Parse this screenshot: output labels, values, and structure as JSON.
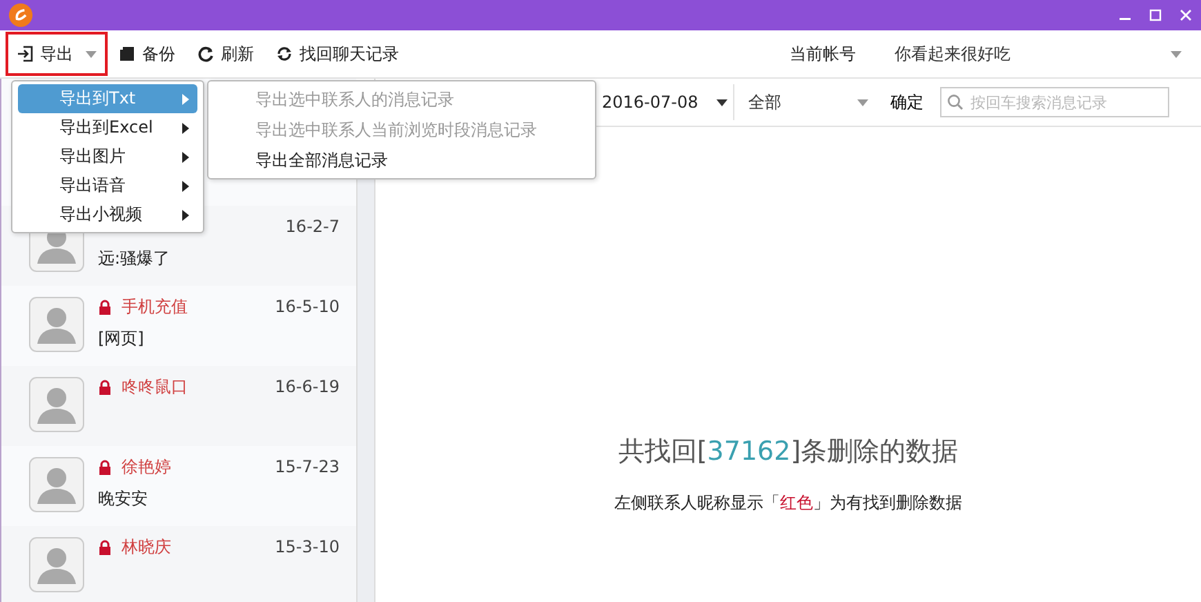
{
  "toolbar": {
    "buttons": [
      {
        "kind": "export",
        "label": "导出",
        "highlighted": true
      },
      {
        "kind": "backup",
        "label": "备份",
        "highlighted": false
      },
      {
        "kind": "refresh",
        "label": "刷新",
        "highlighted": false
      },
      {
        "kind": "recover",
        "label": "找回聊天记录",
        "highlighted": false
      }
    ],
    "account_label": "当前帐号",
    "account": "你看起来很好吃"
  },
  "filter": {
    "date": "2016-07-08",
    "type": "全部",
    "confirm": "确定",
    "search": {
      "placeholder": "按回车搜索消息记录"
    }
  },
  "export_menu": [
    {
      "label": "导出到Txt",
      "selected": true
    },
    {
      "label": "导出到Excel",
      "selected": false
    },
    {
      "label": "导出图片",
      "selected": false
    },
    {
      "label": "导出语音",
      "selected": false
    },
    {
      "label": "导出小视频",
      "selected": false
    }
  ],
  "submenu": [
    {
      "label": "导出选中联系人的消息记录",
      "disabled": true
    },
    {
      "label": "导出选中联系人当前浏览时段消息记录",
      "disabled": true
    },
    {
      "label": "导出全部消息记录",
      "disabled": false
    }
  ],
  "contacts": [
    {
      "date": "16-2-7",
      "message": "远:骚爆了",
      "locked": false
    },
    {
      "name": "手机充值",
      "date": "16-5-10",
      "message": "[网页]",
      "locked": true
    },
    {
      "name": "咚咚鼠口",
      "date": "16-6-19",
      "locked": true
    },
    {
      "name": "徐艳婷",
      "date": "15-7-23",
      "message": "晚安安",
      "locked": true
    },
    {
      "name": "林晓庆",
      "date": "15-3-10",
      "locked": true
    }
  ],
  "summary": {
    "before": "共找回[",
    "count": "37162",
    "after": "]条删除的数据"
  },
  "note": {
    "before": "左侧联系人昵称显示「",
    "highlight": "红色",
    "after": "」为有找到删除数据"
  }
}
